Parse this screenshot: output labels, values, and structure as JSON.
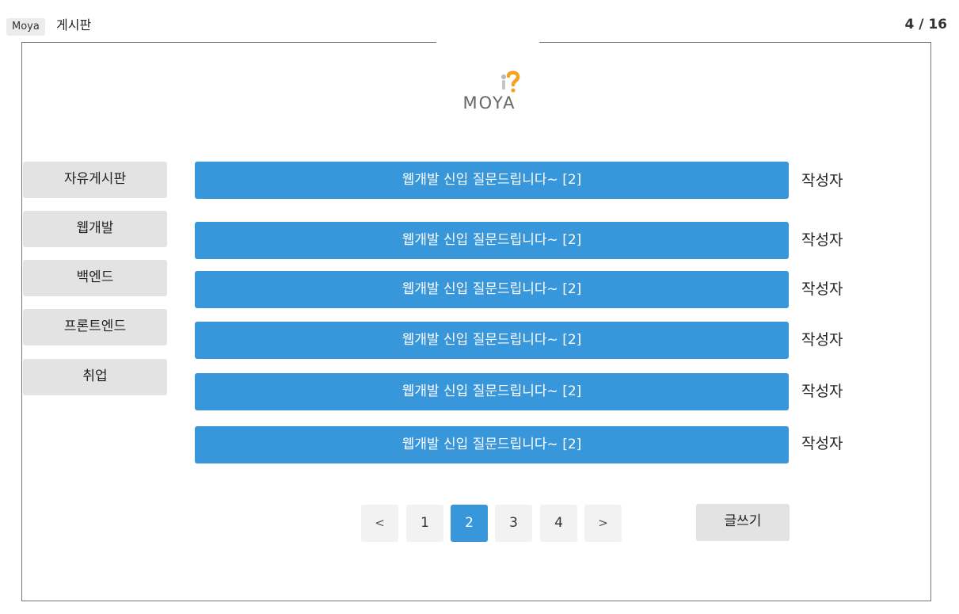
{
  "header": {
    "app_tag": "Moya",
    "title": "게시판",
    "page_counter": "4 / 16"
  },
  "logo": {
    "text": "MOYA",
    "icon": "question-figure-logo"
  },
  "sidebar": {
    "items": [
      {
        "label": "자유게시판"
      },
      {
        "label": "웹개발"
      },
      {
        "label": "백엔드"
      },
      {
        "label": "프론트엔드"
      },
      {
        "label": "취업"
      }
    ]
  },
  "posts": [
    {
      "title": "웹개발 신입 질문드립니다~ [2]",
      "author": "작성자"
    },
    {
      "title": "웹개발 신입 질문드립니다~ [2]",
      "author": "작성자"
    },
    {
      "title": "웹개발 신입 질문드립니다~ [2]",
      "author": "작성자"
    },
    {
      "title": "웹개발 신입 질문드립니다~ [2]",
      "author": "작성자"
    },
    {
      "title": "웹개발 신입 질문드립니다~ [2]",
      "author": "작성자"
    },
    {
      "title": "웹개발 신입 질문드립니다~ [2]",
      "author": "작성자"
    }
  ],
  "pagination": {
    "prev": "<",
    "pages": [
      "1",
      "2",
      "3",
      "4"
    ],
    "current": "2",
    "next": ">"
  },
  "actions": {
    "write_label": "글쓰기"
  },
  "colors": {
    "accent": "#3896db",
    "button_gray": "#e3e3e3",
    "pager_gray": "#f2f2f2",
    "logo_orange": "#f2a321"
  }
}
